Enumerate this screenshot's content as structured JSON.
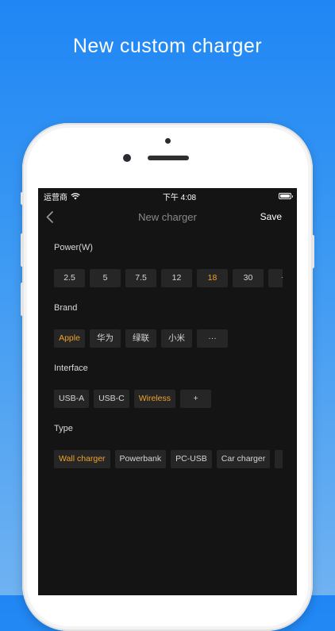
{
  "headline": "New custom charger",
  "status_bar": {
    "carrier": "运营商",
    "time": "下午 4:08"
  },
  "nav": {
    "title": "New charger",
    "save_label": "Save"
  },
  "sections": {
    "power": {
      "title": "Power(W)",
      "options": [
        "2.5",
        "5",
        "7.5",
        "12",
        "18",
        "30",
        "+"
      ],
      "selected": "18"
    },
    "brand": {
      "title": "Brand",
      "options": [
        "Apple",
        "华为",
        "绿联",
        "小米",
        "···"
      ],
      "selected": "Apple"
    },
    "interface": {
      "title": "Interface",
      "options": [
        "USB-A",
        "USB-C",
        "Wireless",
        "+"
      ],
      "selected": "Wireless"
    },
    "type": {
      "title": "Type",
      "options": [
        "Wall charger",
        "Powerbank",
        "PC-USB",
        "Car charger",
        ""
      ],
      "selected": "Wall charger"
    }
  },
  "colors": {
    "accent": "#f0a326",
    "background": "#141414",
    "chip": "#262626"
  }
}
